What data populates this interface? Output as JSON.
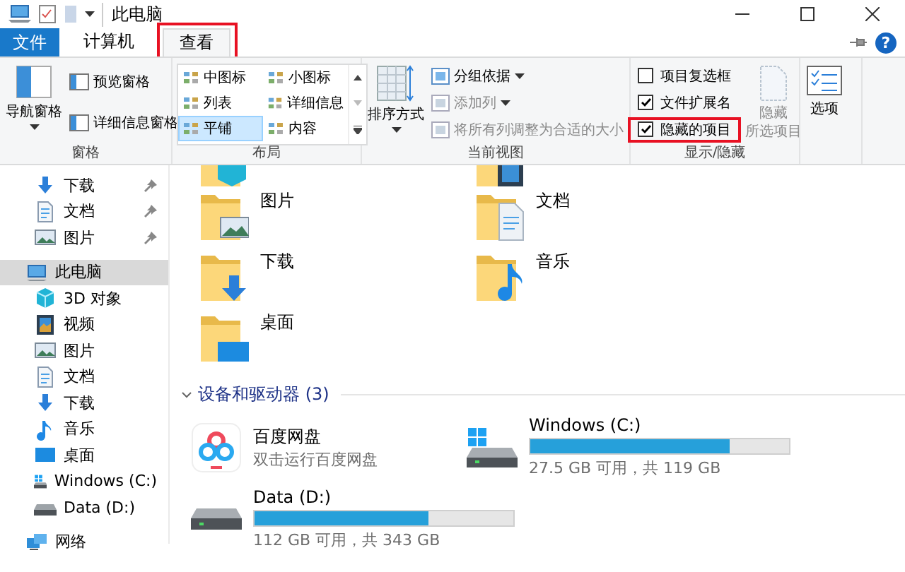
{
  "window": {
    "title": "此电脑"
  },
  "ribbon_tabs": [
    {
      "label": "文件",
      "kind": "file",
      "selected": false,
      "highlighted": false
    },
    {
      "label": "计算机",
      "kind": "tab",
      "selected": false,
      "highlighted": false
    },
    {
      "label": "查看",
      "kind": "tab",
      "selected": true,
      "highlighted": true
    }
  ],
  "help_button": "?",
  "ribbon": {
    "panes": {
      "label": "窗格",
      "navigation_pane": "导航窗格",
      "buttons": [
        "预览窗格",
        "详细信息窗格"
      ]
    },
    "layout": {
      "label": "布局",
      "options": [
        {
          "label": "中图标",
          "selected": false
        },
        {
          "label": "小图标",
          "selected": false
        },
        {
          "label": "列表",
          "selected": false
        },
        {
          "label": "详细信息",
          "selected": false
        },
        {
          "label": "平铺",
          "selected": true
        },
        {
          "label": "内容",
          "selected": false
        }
      ]
    },
    "current_view": {
      "label": "当前视图",
      "sort_button": "排序方式",
      "commands": [
        {
          "label": "分组依据",
          "dropdown": true,
          "disabled": false
        },
        {
          "label": "添加列",
          "dropdown": true,
          "disabled": true
        },
        {
          "label": "将所有列调整为合适的大小",
          "dropdown": false,
          "disabled": true
        }
      ]
    },
    "show_hide": {
      "label": "显示/隐藏",
      "checkboxes": [
        {
          "label": "项目复选框",
          "checked": false,
          "highlighted": false
        },
        {
          "label": "文件扩展名",
          "checked": true,
          "highlighted": false
        },
        {
          "label": "隐藏的项目",
          "checked": true,
          "highlighted": true
        }
      ],
      "hide_selected": {
        "lines": [
          "隐藏",
          "所选项目"
        ],
        "disabled": true
      }
    },
    "options_button": "选项"
  },
  "sidebar": {
    "quick_access": [
      {
        "label": "下载",
        "kind": "downloads",
        "pinned": true,
        "selected": false
      },
      {
        "label": "文档",
        "kind": "docs",
        "pinned": true,
        "selected": false
      },
      {
        "label": "图片",
        "kind": "pictures",
        "pinned": true,
        "selected": false
      }
    ],
    "tree": [
      {
        "label": "此电脑",
        "kind": "pc",
        "selected": true,
        "children": [
          {
            "label": "3D 对象",
            "kind": "cube",
            "selected": false
          },
          {
            "label": "视频",
            "kind": "video",
            "selected": false
          },
          {
            "label": "图片",
            "kind": "pictures",
            "selected": false
          },
          {
            "label": "文档",
            "kind": "docs",
            "selected": false
          },
          {
            "label": "下载",
            "kind": "downloads",
            "selected": false
          },
          {
            "label": "音乐",
            "kind": "music",
            "selected": false
          },
          {
            "label": "桌面",
            "kind": "desktop",
            "selected": false
          },
          {
            "label": "Windows (C:)",
            "kind": "system",
            "selected": false
          },
          {
            "label": "Data (D:)",
            "kind": "drive",
            "selected": false
          }
        ]
      },
      {
        "label": "网络",
        "kind": "network",
        "selected": false
      }
    ]
  },
  "folders": [
    {
      "kind": "cube"
    },
    {
      "kind": "video"
    },
    {
      "label": "图片",
      "kind": "pictures"
    },
    {
      "label": "文档",
      "kind": "docs"
    },
    {
      "label": "下载",
      "kind": "downloads"
    },
    {
      "label": "音乐",
      "kind": "music"
    },
    {
      "label": "桌面",
      "kind": "desktop"
    }
  ],
  "devices": {
    "title": "设备和驱动器 (3)",
    "expanded": true,
    "items": [
      {
        "kind": "app",
        "name": "百度网盘",
        "subtitle": "双击运行百度网盘"
      },
      {
        "kind": "system",
        "name": "Windows (C:)",
        "level": 0.77,
        "reading": "27.5 GB 可用，共 119 GB"
      },
      {
        "kind": "drive",
        "name": "Data (D:)",
        "level": 0.67,
        "reading": "112 GB 可用，共 343 GB"
      }
    ]
  }
}
